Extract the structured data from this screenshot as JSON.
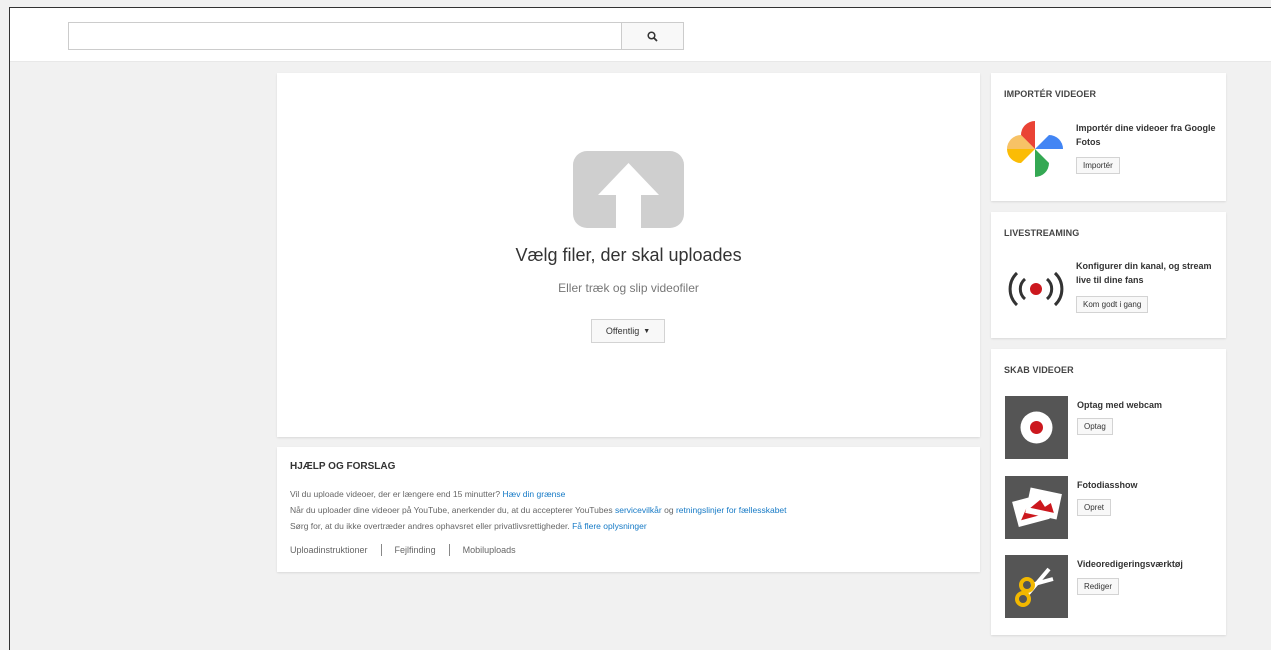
{
  "search": {
    "placeholder": "",
    "value": ""
  },
  "upload": {
    "title": "Vælg filer, der skal uploades",
    "subtitle": "Eller træk og slip videofiler",
    "privacy": "Offentlig"
  },
  "help": {
    "title": "HJÆLP OG FORSLAG",
    "line1_text": "Vil du uploade videoer, der er længere end 15 minutter?",
    "line1_link": "Hæv din grænse",
    "line2_text": "Når du uploader dine videoer på YouTube, anerkender du, at du accepterer YouTubes",
    "line2_link1": "servicevilkår",
    "line2_and": "og",
    "line2_link2": "retningslinjer for fællesskabet",
    "line3_text": "Sørg for, at du ikke overtræder andres ophavsret eller privatlivsrettigheder.",
    "line3_link": "Få flere oplysninger",
    "links": [
      "Uploadinstruktioner",
      "Fejlfinding",
      "Mobiluploads"
    ]
  },
  "import": {
    "title": "IMPORTÉR VIDEOER",
    "text": "Importér dine videoer fra Google Fotos",
    "button": "Importér"
  },
  "live": {
    "title": "LIVESTREAMING",
    "text": "Konfigurer din kanal, og stream live til dine fans",
    "button": "Kom godt i gang"
  },
  "create": {
    "title": "SKAB VIDEOER",
    "items": [
      {
        "label": "Optag med webcam",
        "button": "Optag",
        "icon": "webcam-record-icon"
      },
      {
        "label": "Fotodiasshow",
        "button": "Opret",
        "icon": "photo-slideshow-icon"
      },
      {
        "label": "Videoredigeringsværktøj",
        "button": "Rediger",
        "icon": "scissors-icon"
      }
    ]
  },
  "colors": {
    "link": "#167ac6",
    "record": "#cc181e",
    "editor_accent": "#f2b800"
  }
}
